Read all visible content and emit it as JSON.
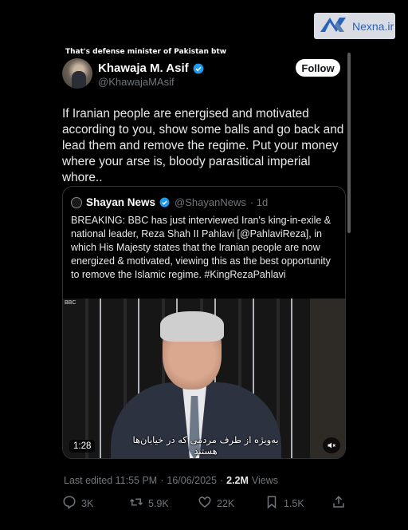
{
  "watermark": {
    "logo_text": "Nexna.ir",
    "icon": "nexna-logo-icon"
  },
  "caption": "That's defense minister of Pakistan btw",
  "tweet": {
    "author_name": "Khawaja M. Asif",
    "author_handle": "@KhawajaMAsif",
    "follow_label": "Follow",
    "text": "If Iranian people are energised and motivated according to you, show some balls and go back and lead them and remove the regime. Put your money where your arse is, bloody parasitical imperial whore..",
    "last_edited": "Last edited 11:55 PM",
    "separator": "·",
    "date": "16/06/2025",
    "views_count": "2.2M",
    "views_label": "Views"
  },
  "quote": {
    "author_name": "Shayan News",
    "author_handle": "@ShayanNews",
    "time": "· 1d",
    "text": "BREAKING: BBC has just interviewed Iran's king-in-exile & national leader, Reza Shah II Pahlavi [@PahlaviReza], in which His Majesty states that the Iranian people are now energized & motivated, viewing this as the best opportunity to remove the Islamic regime. #KingRezaPahlavi",
    "video": {
      "duration": "1:28",
      "subtitle": "به‌ویژه از طرف مردمی که در خیابان‌ها هستند",
      "channel_tag": "BBC"
    }
  },
  "actions": {
    "replies": "3K",
    "reposts": "5.9K",
    "likes": "22K",
    "bookmarks": "1.5K"
  },
  "colors": {
    "background": "#000000",
    "verified": "#1d9bf0",
    "muted_text": "#71767b",
    "watermark_accent": "#2a62b8"
  }
}
